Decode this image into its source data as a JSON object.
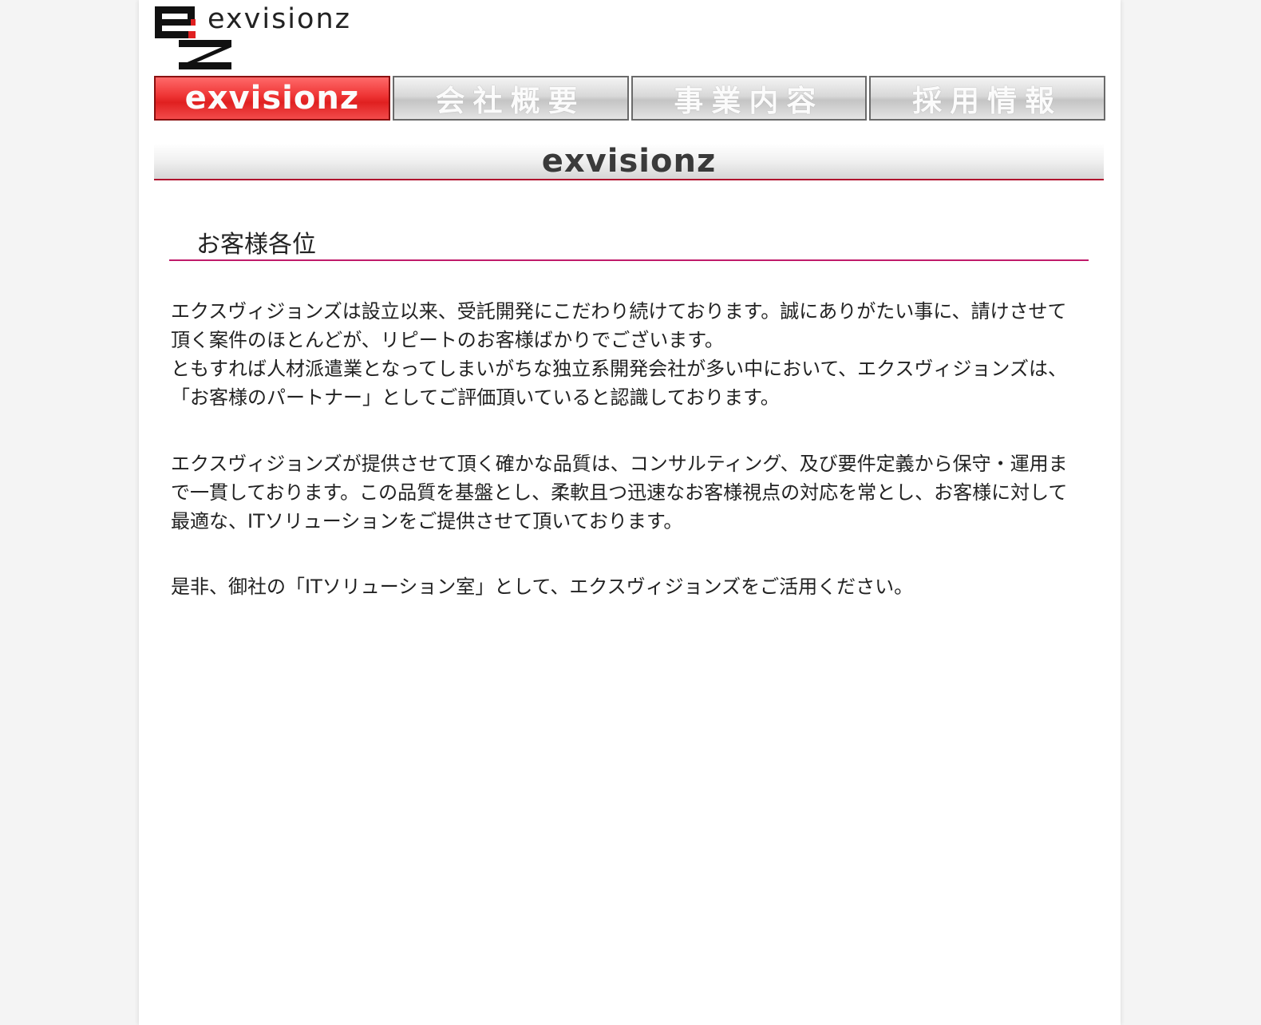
{
  "logo": {
    "text": "exvisionz",
    "mark_colors": {
      "primary": "#111111",
      "accent": "#e02020"
    }
  },
  "nav": {
    "items": [
      {
        "label": "exvisionz",
        "active": true
      },
      {
        "label": "会社概要",
        "active": false
      },
      {
        "label": "事業内容",
        "active": false
      },
      {
        "label": "採用情報",
        "active": false
      }
    ]
  },
  "banner": {
    "title": "exvisionz"
  },
  "content": {
    "heading": "お客様各位",
    "paragraph1": "エクスヴィジョンズは設立以来、受託開発にこだわり続けております。誠にありがたい事に、請けさせて頂く案件のほとんどが、リピートのお客様ばかりでございます。",
    "paragraph1b": "ともすれば人材派遣業となってしまいがちな独立系開発会社が多い中において、エクスヴィジョンズは、「お客様のパートナー」としてご評価頂いていると認識しております。",
    "paragraph2": "エクスヴィジョンズが提供させて頂く確かな品質は、コンサルティング、及び要件定義から保守・運用まで一貫しております。この品質を基盤とし、柔軟且つ迅速なお客様視点の対応を常とし、お客様に対して最適な、ITソリューションをご提供させて頂いております。",
    "paragraph3": "是非、御社の「ITソリューション室」として、エクスヴィジョンズをご活用ください。"
  },
  "colors": {
    "accent_red": "#e02020",
    "heading_rule": "#c01a6a",
    "banner_rule": "#b0102e"
  }
}
